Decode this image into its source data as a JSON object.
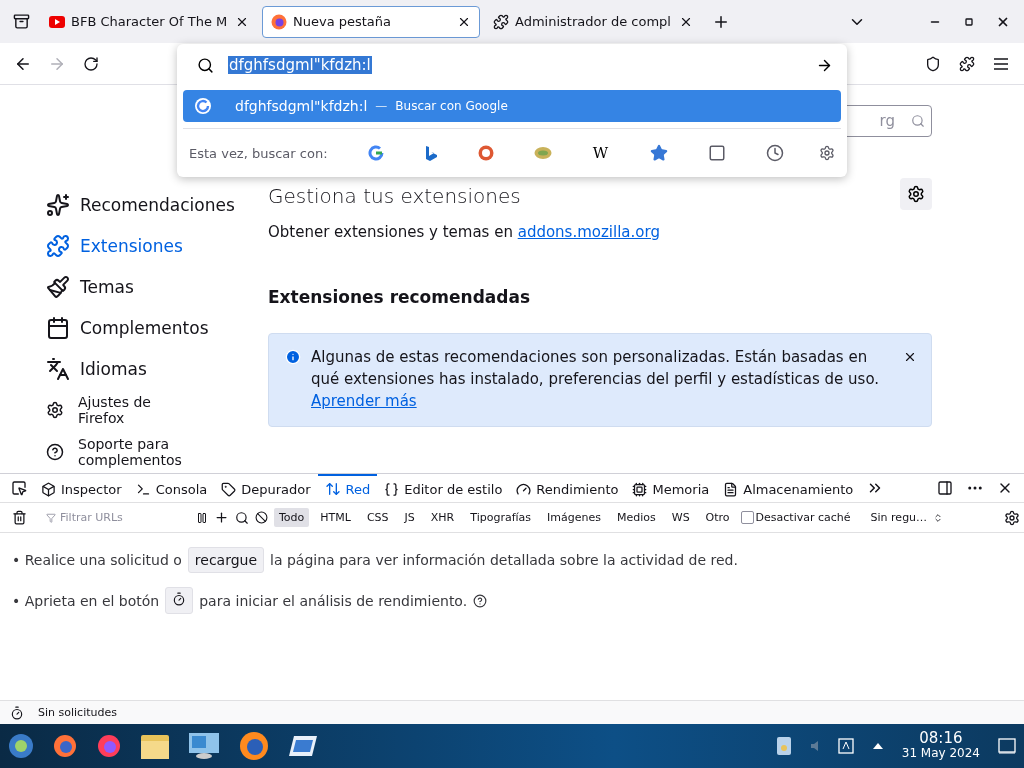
{
  "tabs": [
    {
      "kind": "video",
      "title": "BFB Character Of The M",
      "selected": false
    },
    {
      "kind": "firefox",
      "title": "Nueva pestaña",
      "selected": true
    },
    {
      "kind": "addons",
      "title": "Administrador de compl",
      "selected": false
    }
  ],
  "urlbar": {
    "value": "dfghfsdgml\"kfdzh:l"
  },
  "suggestion": {
    "text": "dfghfsdgml\"kfdzh:l",
    "separator": "—",
    "action": "Buscar con Google",
    "selected": true
  },
  "search_with": {
    "label": "Esta vez, buscar con:",
    "engines": [
      {
        "kind": "google"
      },
      {
        "kind": "bing"
      },
      {
        "kind": "duckduckgo"
      },
      {
        "kind": "ebay"
      },
      {
        "kind": "wikipedia",
        "glyph": "W"
      },
      {
        "kind": "bookmarks"
      },
      {
        "kind": "tabs"
      },
      {
        "kind": "history"
      }
    ]
  },
  "addons_search": {
    "value": "rg"
  },
  "sidebar": {
    "items": [
      {
        "kind": "recommendations",
        "label": "Recomendaciones",
        "selected": false
      },
      {
        "kind": "extensions",
        "label": "Extensiones",
        "selected": true
      },
      {
        "kind": "themes",
        "label": "Temas",
        "selected": false
      },
      {
        "kind": "plugins",
        "label": "Complementos",
        "selected": false
      },
      {
        "kind": "languages",
        "label": "Idiomas",
        "selected": false
      }
    ],
    "footer": [
      {
        "kind": "settings",
        "label": "Ajustes de Firefox"
      },
      {
        "kind": "help",
        "label": "Soporte para complementos"
      }
    ]
  },
  "main": {
    "heading": "Gestiona tus extensiones",
    "intro": "Obtener extensiones y temas en",
    "intro_link": "addons.mozilla.org",
    "section_title": "Extensiones recomendadas",
    "notice": {
      "text": "Algunas de estas recomendaciones son personalizadas. Están basadas en qué extensiones has instalado, preferencias del perfil y estadísticas de uso.",
      "link": "Aprender más"
    }
  },
  "devtools": {
    "tabs": [
      {
        "kind": "inspector",
        "label": "Inspector",
        "selected": false
      },
      {
        "kind": "console",
        "label": "Consola",
        "selected": false
      },
      {
        "kind": "debugger",
        "label": "Depurador",
        "selected": false
      },
      {
        "kind": "network",
        "label": "Red",
        "selected": true
      },
      {
        "kind": "style",
        "label": "Editor de estilo",
        "selected": false
      },
      {
        "kind": "performance",
        "label": "Rendimiento",
        "selected": false
      },
      {
        "kind": "memory",
        "label": "Memoria",
        "selected": false
      },
      {
        "kind": "storage",
        "label": "Almacenamiento",
        "selected": false
      }
    ],
    "filter_placeholder": "Filtrar URLs",
    "types": [
      {
        "label": "Todo",
        "selected": true
      },
      {
        "label": "HTML",
        "selected": false
      },
      {
        "label": "CSS",
        "selected": false
      },
      {
        "label": "JS",
        "selected": false
      },
      {
        "label": "XHR",
        "selected": false
      },
      {
        "label": "Tipografías",
        "selected": false
      },
      {
        "label": "Imágenes",
        "selected": false
      },
      {
        "label": "Medios",
        "selected": false
      },
      {
        "label": "WS",
        "selected": false
      },
      {
        "label": "Otro",
        "selected": false
      }
    ],
    "disable_cache": {
      "label": "Desactivar caché",
      "checked": false
    },
    "throttle": "Sin regu…",
    "bullet": "•",
    "hint1": {
      "before": "Realice una solicitud o",
      "button": "recargue",
      "after": "la página para ver información detallada sobre la actividad de red."
    },
    "hint2": {
      "before": "Aprieta en el botón",
      "after": "para iniciar el análisis de rendimiento."
    },
    "status": "Sin solicitudes"
  },
  "taskbar": {
    "time": "08:16",
    "date": "31 May 2024"
  }
}
